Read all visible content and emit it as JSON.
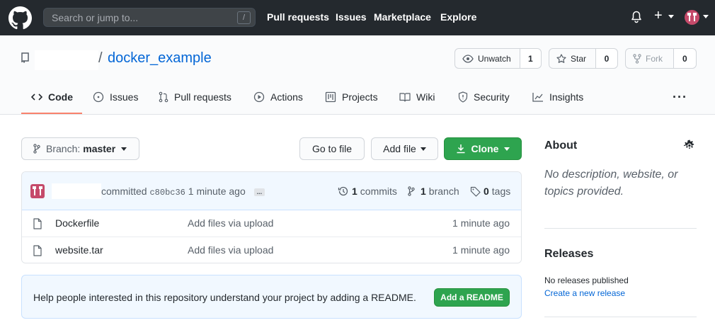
{
  "header": {
    "search_placeholder": "Search or jump to...",
    "search_shortcut": "/",
    "nav": [
      "Pull requests",
      "Issues",
      "Marketplace",
      "Explore"
    ],
    "plus": "+"
  },
  "repo": {
    "name": "docker_example",
    "separator": "/",
    "watch": {
      "label": "Unwatch",
      "count": "1"
    },
    "star": {
      "label": "Star",
      "count": "0"
    },
    "fork": {
      "label": "Fork",
      "count": "0"
    }
  },
  "tabs": [
    {
      "label": "Code",
      "icon": "code-icon"
    },
    {
      "label": "Issues",
      "icon": "issue-icon"
    },
    {
      "label": "Pull requests",
      "icon": "pull-request-icon"
    },
    {
      "label": "Actions",
      "icon": "play-icon"
    },
    {
      "label": "Projects",
      "icon": "project-icon"
    },
    {
      "label": "Wiki",
      "icon": "book-icon"
    },
    {
      "label": "Security",
      "icon": "shield-icon"
    },
    {
      "label": "Insights",
      "icon": "graph-icon"
    }
  ],
  "more": "···",
  "toolbar": {
    "branch_prefix": "Branch:",
    "branch_name": "master",
    "go_to_file": "Go to file",
    "add_file": "Add file",
    "clone": "Clone"
  },
  "commit": {
    "action": "committed",
    "sha": "c80bc36",
    "time": "1 minute ago",
    "ellipsis": "...",
    "commits_count": "1",
    "commits_label": "commits",
    "branch_count": "1",
    "branch_label": "branch",
    "tags_count": "0",
    "tags_label": "tags"
  },
  "files": [
    {
      "name": "Dockerfile",
      "message": "Add files via upload",
      "age": "1 minute ago"
    },
    {
      "name": "website.tar",
      "message": "Add files via upload",
      "age": "1 minute ago"
    }
  ],
  "readme": {
    "text": "Help people interested in this repository understand your project by adding a README.",
    "button": "Add a README"
  },
  "sidebar": {
    "about_title": "About",
    "about_desc": "No description, website, or topics provided.",
    "releases_title": "Releases",
    "releases_none": "No releases published",
    "releases_link": "Create a new release"
  },
  "colors": {
    "header_bg": "#24292e",
    "link": "#0366d6",
    "green": "#2ea44f",
    "tab_accent": "#f9826c"
  }
}
